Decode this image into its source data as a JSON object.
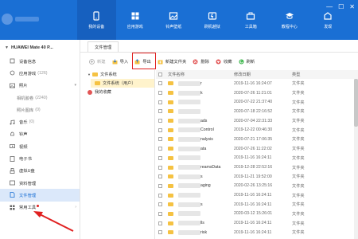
{
  "window": {
    "minimize": "—",
    "maximize": "☐",
    "close": "✕"
  },
  "topnav": [
    {
      "label": "我的设备",
      "icon": "phone-icon",
      "active": true
    },
    {
      "label": "应用游戏",
      "icon": "apps-icon",
      "active": false
    },
    {
      "label": "铃声壁纸",
      "icon": "wallpaper-icon",
      "active": false
    },
    {
      "label": "刷机越狱",
      "icon": "flash-icon",
      "active": false
    },
    {
      "label": "工具箱",
      "icon": "toolbox-icon",
      "active": false
    },
    {
      "label": "教程中心",
      "icon": "tutorial-icon",
      "active": false
    },
    {
      "label": "发现",
      "icon": "discover-icon",
      "active": false
    }
  ],
  "device": {
    "name": "HUAWEI Mate 40 P..."
  },
  "sidebar": [
    {
      "label": "设备信息",
      "icon": "info-icon",
      "count": "",
      "sub": false
    },
    {
      "label": "应用游戏",
      "icon": "app-icon",
      "count": "(126)",
      "sub": false
    },
    {
      "label": "照片",
      "icon": "photo-icon",
      "count": "",
      "sub": false
    },
    {
      "label": "相机胶卷",
      "icon": "",
      "count": "(2240)",
      "sub": true
    },
    {
      "label": "照片图库",
      "icon": "",
      "count": "(0)",
      "sub": true
    },
    {
      "label": "音乐",
      "icon": "music-icon",
      "count": "(0)",
      "sub": false
    },
    {
      "label": "铃声",
      "icon": "bell-icon",
      "count": "",
      "sub": false
    },
    {
      "label": "视频",
      "icon": "video-icon",
      "count": "",
      "sub": false
    },
    {
      "label": "电子书",
      "icon": "ebook-icon",
      "count": "",
      "sub": false
    },
    {
      "label": "虚拟U盘",
      "icon": "usb-icon",
      "count": "",
      "sub": false
    },
    {
      "label": "资料管理",
      "icon": "data-icon",
      "count": "",
      "sub": false
    },
    {
      "label": "文件管理",
      "icon": "file-icon",
      "count": "",
      "sub": false,
      "active": true
    },
    {
      "label": "常用工具",
      "icon": "tools-icon",
      "count": "",
      "sub": false
    }
  ],
  "tabs": [
    {
      "label": "文件管理"
    }
  ],
  "toolbar": [
    {
      "label": "新建",
      "icon": "new-icon",
      "disabled": true
    },
    {
      "label": "导入",
      "icon": "import-icon",
      "disabled": false
    },
    {
      "label": "导出",
      "icon": "export-icon",
      "disabled": false
    },
    {
      "label": "新建文件夹",
      "icon": "new-folder-icon",
      "disabled": false
    },
    {
      "label": "删除",
      "icon": "delete-icon",
      "disabled": false
    },
    {
      "label": "收藏",
      "icon": "favorite-icon",
      "disabled": false
    },
    {
      "label": "刷新",
      "icon": "refresh-icon",
      "disabled": false
    }
  ],
  "tree": {
    "root": "文件系统",
    "child": "文件系统（用户）",
    "favorites": "我的收藏"
  },
  "filelist": {
    "headers": {
      "name": "文件名称",
      "date": "修改日期",
      "type": "类型"
    },
    "rows": [
      {
        "name": "r",
        "date": "2019-11-16 16:24:07",
        "type": "文件夹"
      },
      {
        "name": "k",
        "date": "2020-07-26 11:21:01",
        "type": "文件夹"
      },
      {
        "name": "",
        "date": "2020-07-22 21:37:40",
        "type": "文件夹"
      },
      {
        "name": "",
        "date": "2020-07-18 22:16:52",
        "type": "文件夹"
      },
      {
        "name": "ads",
        "date": "2020-07-04 22:31:33",
        "type": "文件夹"
      },
      {
        "name": "Control",
        "date": "2019-12-22 00:46:30",
        "type": "文件夹"
      },
      {
        "name": "nalysis",
        "date": "2020-07-21 17:06:35",
        "type": "文件夹"
      },
      {
        "name": "ata",
        "date": "2020-07-26 11:22:02",
        "type": "文件夹"
      },
      {
        "name": "",
        "date": "2019-11-16 16:24:11",
        "type": "文件夹"
      },
      {
        "name": "reamsData",
        "date": "2019-12-28 22:52:16",
        "type": "文件夹"
      },
      {
        "name": "s",
        "date": "2019-11-21 19:52:00",
        "type": "文件夹"
      },
      {
        "name": "aging",
        "date": "2020-02-26 13:25:16",
        "type": "文件夹"
      },
      {
        "name": "",
        "date": "2019-11-16 16:24:11",
        "type": "文件夹"
      },
      {
        "name": "s",
        "date": "2019-11-16 16:24:11",
        "type": "文件夹"
      },
      {
        "name": "",
        "date": "2020-03-12 15:26:01",
        "type": "文件夹"
      },
      {
        "name": "lls",
        "date": "2019-11-16 16:24:11",
        "type": "文件夹"
      },
      {
        "name": "risk",
        "date": "2019-11-16 16:24:11",
        "type": "文件夹"
      }
    ]
  },
  "colors": {
    "nav_bg": "#1a6fd4",
    "accent": "#1a6fd4",
    "folder": "#f5c242",
    "annotation": "#e02020"
  }
}
